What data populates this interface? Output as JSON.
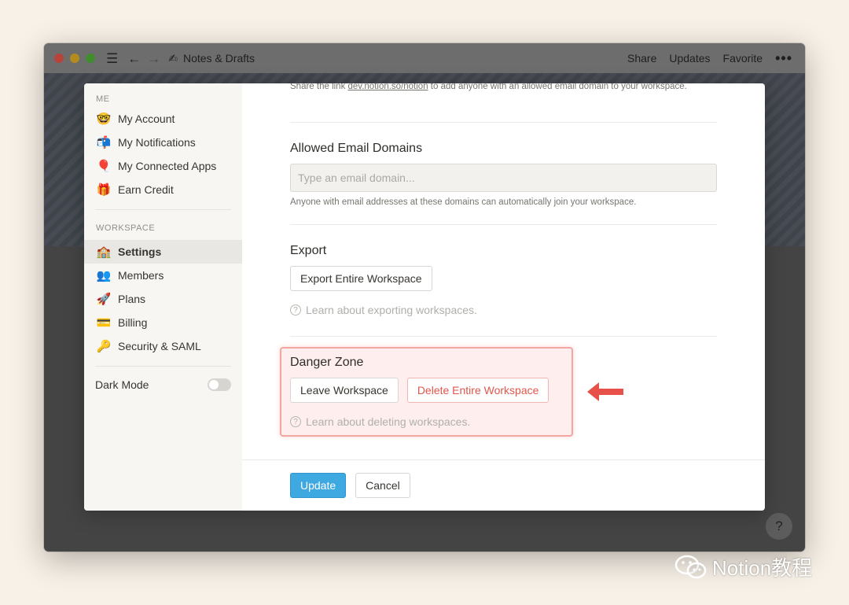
{
  "window": {
    "title": "Notes & Drafts",
    "title_emoji": "✍",
    "menu_icon": "☰",
    "back_icon": "←",
    "forward_icon": "→",
    "actions": [
      "Share",
      "Updates",
      "Favorite"
    ],
    "more_icon": "•••",
    "help_label": "?"
  },
  "sidebar": {
    "me_heading": "ME",
    "me_items": [
      {
        "emoji": "🤓",
        "label": "My Account"
      },
      {
        "emoji": "📬",
        "label": "My Notifications"
      },
      {
        "emoji": "🎈",
        "label": "My Connected Apps"
      },
      {
        "emoji": "🎁",
        "label": "Earn Credit"
      }
    ],
    "workspace_heading": "WORKSPACE",
    "workspace_items": [
      {
        "emoji": "🏫",
        "label": "Settings",
        "active": true
      },
      {
        "emoji": "👥",
        "label": "Members"
      },
      {
        "emoji": "🚀",
        "label": "Plans"
      },
      {
        "emoji": "💳",
        "label": "Billing"
      },
      {
        "emoji": "🔑",
        "label": "Security & SAML"
      }
    ],
    "dark_mode_label": "Dark Mode",
    "dark_mode_on": false
  },
  "content": {
    "share_text_before": "Share the link ",
    "share_link": "dev.notion.so/notion",
    "share_text_after": " to add anyone with an allowed email domain to your workspace.",
    "allowed_domains_title": "Allowed Email Domains",
    "allowed_domains_placeholder": "Type an email domain...",
    "allowed_domains_hint": "Anyone with email addresses at these domains can automatically join your workspace.",
    "export_title": "Export",
    "export_button": "Export Entire Workspace",
    "export_learn": "Learn about exporting workspaces.",
    "danger_title": "Danger Zone",
    "leave_button": "Leave Workspace",
    "delete_button": "Delete Entire Workspace",
    "danger_learn": "Learn about deleting workspaces.",
    "help_glyph": "?"
  },
  "footer": {
    "update_button": "Update",
    "cancel_button": "Cancel"
  },
  "watermark": {
    "text": "Notion教程"
  },
  "colors": {
    "primary": "#3ea8e0",
    "danger": "#e0564c",
    "arrow": "#e8504a"
  }
}
